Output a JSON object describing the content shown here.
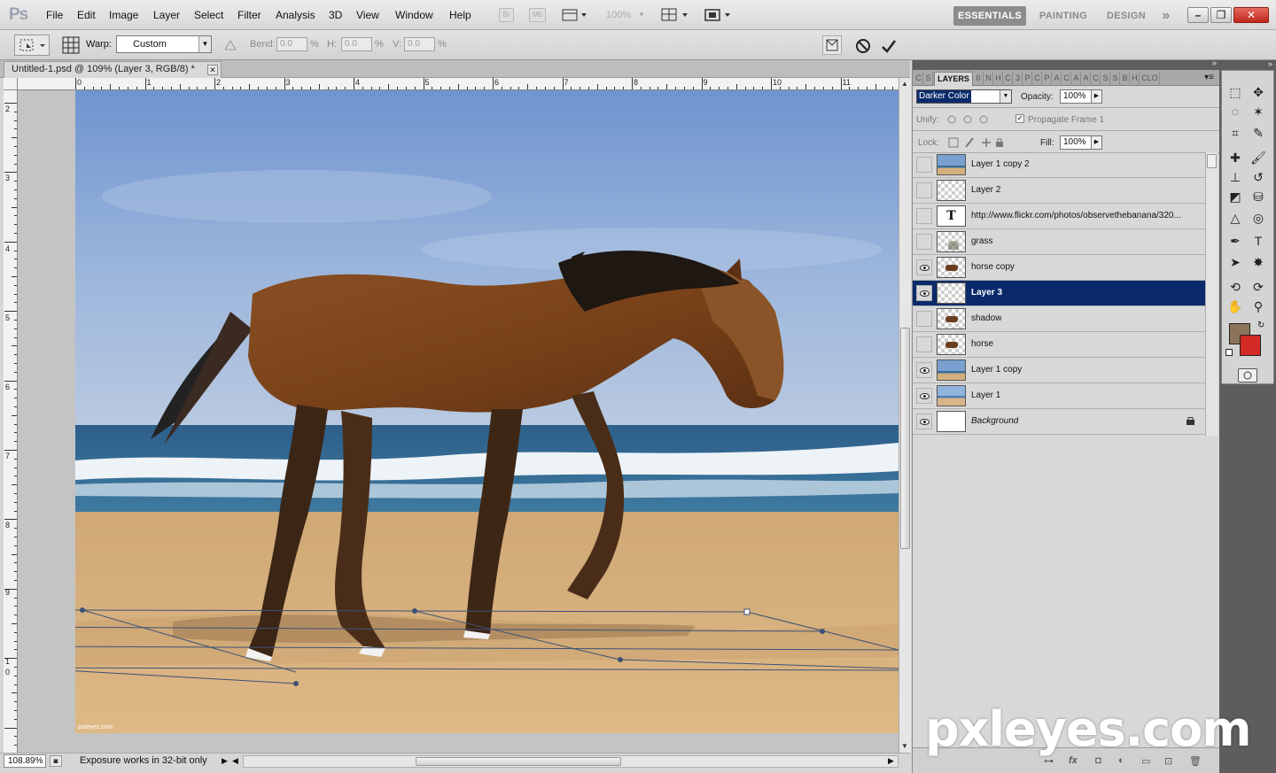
{
  "menubar": {
    "logo": "Ps",
    "items": [
      "File",
      "Edit",
      "Image",
      "Layer",
      "Select",
      "Filter",
      "Analysis",
      "3D",
      "View",
      "Window",
      "Help"
    ],
    "bridge": "Br",
    "minibridge": "Mb",
    "zoom": "100%",
    "workspaces": [
      "ESSENTIALS",
      "PAINTING",
      "DESIGN"
    ],
    "more": "»"
  },
  "options": {
    "warp_label": "Warp:",
    "warp_value": "Custom",
    "bend_label": "Bend:",
    "bend_value": "0.0",
    "h_label": "H:",
    "h_value": "0.0",
    "v_label": "V:",
    "v_value": "0.0",
    "pct": "%"
  },
  "document": {
    "tab_title": "Untitled-1.psd @ 109% (Layer 3, RGB/8) *",
    "zoom": "108.89%",
    "status": "Exposure works in 32-bit only",
    "watermark_small": "pxleyes.com"
  },
  "rulers": {
    "top": [
      "0",
      "1",
      "2",
      "3",
      "4",
      "5",
      "6",
      "7",
      "8",
      "9",
      "10",
      "11"
    ],
    "left": [
      "2",
      "3",
      "4",
      "5",
      "6",
      "7",
      "8",
      "9",
      "1",
      "0"
    ]
  },
  "panel": {
    "tabs": [
      "C",
      "S",
      "LAYERS",
      "II",
      "N",
      "H",
      "C",
      "3",
      "P",
      "C",
      "P",
      "A",
      "C",
      "A",
      "A",
      "C",
      "S",
      "S",
      "B",
      "H",
      "CLO"
    ],
    "blend_mode": "Darker Color",
    "opacity_label": "Opacity:",
    "opacity": "100%",
    "unify_label": "Unify:",
    "propagate": "Propagate Frame 1",
    "lock_label": "Lock:",
    "fill_label": "Fill:",
    "fill": "100%"
  },
  "layers": [
    {
      "name": "Layer 1 copy 2",
      "visible": false,
      "thumb": "beach"
    },
    {
      "name": "Layer 2",
      "visible": false,
      "thumb": "checker"
    },
    {
      "name": "http://www.flickr.com/photos/observethebanana/320...",
      "visible": false,
      "thumb": "text"
    },
    {
      "name": "grass",
      "visible": false,
      "thumb": "grass"
    },
    {
      "name": "horse copy",
      "visible": true,
      "thumb": "horse"
    },
    {
      "name": "Layer 3",
      "visible": true,
      "thumb": "checker",
      "selected": true
    },
    {
      "name": "shadow",
      "visible": false,
      "thumb": "horse"
    },
    {
      "name": "horse",
      "visible": false,
      "thumb": "horse"
    },
    {
      "name": "Layer 1 copy",
      "visible": true,
      "thumb": "beach"
    },
    {
      "name": "Layer 1",
      "visible": true,
      "thumb": "beach2"
    },
    {
      "name": "Background",
      "visible": true,
      "thumb": "white",
      "locked": true
    }
  ],
  "watermark": "pxleyes.com",
  "colors": {
    "foreground": "#8b7459",
    "background": "#d42a26",
    "selection": "#0b2a6b"
  }
}
